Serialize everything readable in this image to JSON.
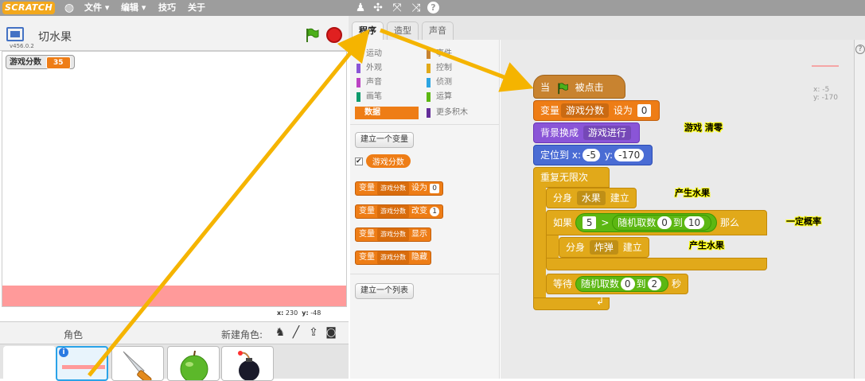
{
  "menubar": {
    "logo": "SCRATCH",
    "items": [
      "文件 ▾",
      "编辑 ▾",
      "技巧",
      "关于"
    ]
  },
  "stage": {
    "project_title": "切水果",
    "version": "v456.0.2",
    "variable_monitor": {
      "name": "游戏分数",
      "value": "35"
    },
    "mouse_x_label": "x:",
    "mouse_x": "230",
    "mouse_y_label": "y:",
    "mouse_y": "-48"
  },
  "sprites": {
    "label": "角色",
    "new_sprite_label": "新建角色:",
    "icons": [
      "sprite-library-icon",
      "paint-icon",
      "upload-icon",
      "camera-icon"
    ]
  },
  "tabs": [
    "程序",
    "造型",
    "声音"
  ],
  "palette": {
    "categories_left": [
      "运动",
      "外观",
      "声音",
      "画笔",
      "数据"
    ],
    "categories_right": [
      "事件",
      "控制",
      "侦测",
      "运算",
      "更多积木"
    ],
    "make_variable": "建立一个变量",
    "variable_checkbox": "游戏分数",
    "blocks": [
      {
        "prefix": "变量",
        "var": "游戏分数",
        "verb": "设为",
        "value": "0"
      },
      {
        "prefix": "变量",
        "var": "游戏分数",
        "verb": "改变",
        "value": "1"
      },
      {
        "prefix": "变量",
        "var": "游戏分数",
        "verb": "显示",
        "value": ""
      },
      {
        "prefix": "变量",
        "var": "游戏分数",
        "verb": "隐藏",
        "value": ""
      }
    ],
    "make_list": "建立一个列表"
  },
  "script": {
    "hat": {
      "text1": "当",
      "text2": "被点击"
    },
    "set_var": {
      "prefix": "变量",
      "var": "游戏分数",
      "verb": "设为",
      "value": "0"
    },
    "switch_backdrop": {
      "text": "背景换成",
      "value": "游戏进行"
    },
    "goto": {
      "text": "定位到",
      "xl": "x:",
      "x": "-5",
      "yl": "y:",
      "y": "-170"
    },
    "forever": "重复无限次",
    "clone1": {
      "text": "分身",
      "value": "水果",
      "verb": "建立"
    },
    "if": {
      "text": "如果",
      "left": "5",
      "op": ">",
      "rand": "随机取数",
      "a": "0",
      "to": "到",
      "b": "10",
      "then": "那么"
    },
    "clone2": {
      "text": "分身",
      "value": "炸弹",
      "verb": "建立"
    },
    "wait": {
      "text": "等待",
      "rand": "随机取数",
      "a": "0",
      "to": "到",
      "b": "2",
      "unit": "秒"
    }
  },
  "sprite_pos": {
    "x": "x: -5",
    "y": "y: -170"
  },
  "annotations": {
    "a1": "游戏 清零",
    "a2": "产生水果",
    "a3": "一定概率",
    "a4": "产生水果"
  },
  "colors": {
    "arrow": "#f5b400",
    "data": "#ee7d16",
    "looks": "#8a55d7",
    "motion": "#4a6cd4",
    "control": "#e1a91a",
    "operator": "#5cb712"
  }
}
